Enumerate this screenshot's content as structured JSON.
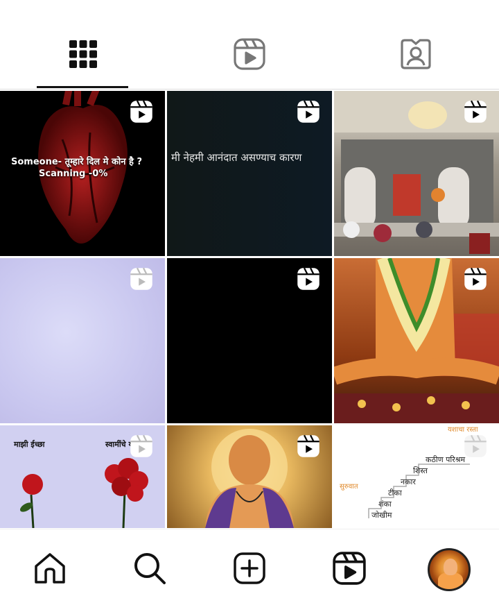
{
  "tabs": [
    {
      "name": "posts",
      "icon": "grid-icon",
      "active": true
    },
    {
      "name": "reels",
      "icon": "reels-icon",
      "active": false
    },
    {
      "name": "tagged",
      "icon": "tagged-person-icon",
      "active": false
    }
  ],
  "grid": [
    {
      "caption_line1": "Someone- तूम्हारे दिल मे कोन है ?",
      "caption_line2": "Scanning -0%",
      "reel": true
    },
    {
      "caption": "मी नेहमी आनंदात असण्याच कारण",
      "reel": true
    },
    {
      "caption": "",
      "reel": true
    },
    {
      "caption": "",
      "reel": true
    },
    {
      "caption": "",
      "reel": true
    },
    {
      "caption": "",
      "reel": true
    },
    {
      "caption_left": "माझी ईच्छा",
      "caption_right": "स्वामींचे योजना",
      "reel": true
    },
    {
      "caption": "",
      "reel": true
    },
    {
      "steps": [
        "कठीण परिश्रम",
        "शिस्त",
        "नकार",
        "टीका",
        "शंका",
        "जोखीम"
      ],
      "start_label": "सुरुवात",
      "top_label": "यशाचा रस्ता",
      "reel": true
    }
  ],
  "bottom_nav": [
    {
      "name": "home",
      "icon": "home-icon"
    },
    {
      "name": "search",
      "icon": "search-icon"
    },
    {
      "name": "create",
      "icon": "add-post-icon"
    },
    {
      "name": "reels",
      "icon": "reels-icon"
    },
    {
      "name": "profile",
      "icon": "profile-avatar"
    }
  ]
}
